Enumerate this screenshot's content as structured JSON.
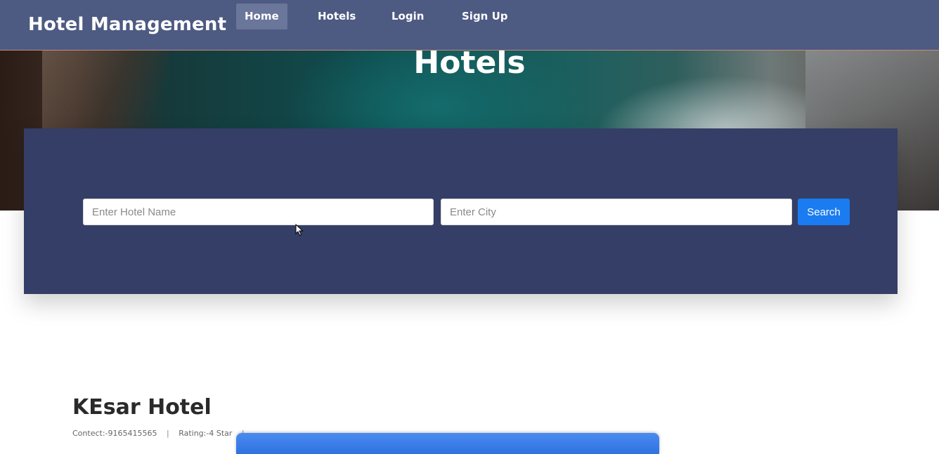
{
  "navbar": {
    "brand": "Hotel Management",
    "items": [
      {
        "label": "Home",
        "active": true
      },
      {
        "label": "Hotels",
        "active": false
      },
      {
        "label": "Login",
        "active": false
      },
      {
        "label": "Sign Up",
        "active": false
      }
    ]
  },
  "hero": {
    "title": "Hotels"
  },
  "search": {
    "hotel_placeholder": "Enter Hotel Name",
    "hotel_value": "",
    "city_placeholder": "Enter City",
    "city_value": "",
    "button_label": "Search"
  },
  "listing": {
    "hotel_name": "KEsar Hotel",
    "contact": "Contect:-9165415565",
    "rating": "Rating:-4 Star",
    "separator": "|"
  },
  "colors": {
    "navbar_bg": "#4d5a82",
    "panel_bg": "#343e66",
    "button_bg": "#1a7cf0",
    "active_nav_bg": "#6a769a"
  },
  "icons": {
    "cursor": "mouse-pointer-icon"
  }
}
